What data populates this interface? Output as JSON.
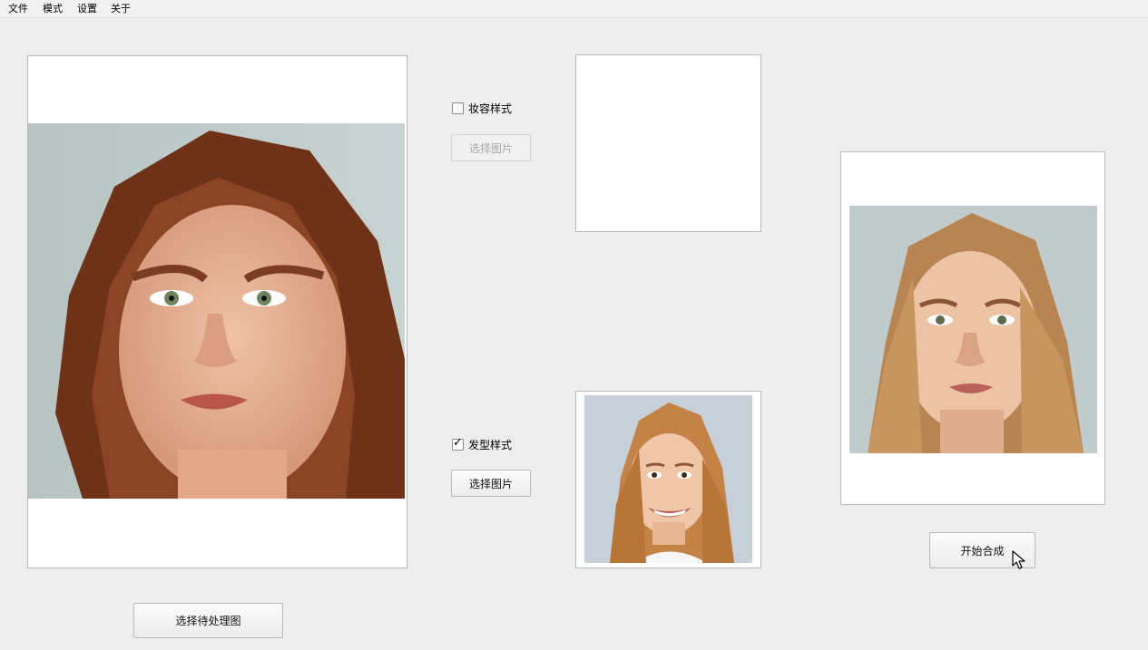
{
  "menu": {
    "items": [
      "文件",
      "模式",
      "设置",
      "关于"
    ]
  },
  "source_panel": {
    "select_button_label": "选择待处理图"
  },
  "makeup": {
    "checkbox_label": "妆容样式",
    "checked": false,
    "select_button_label": "选择图片",
    "button_enabled": false
  },
  "hair": {
    "checkbox_label": "发型样式",
    "checked": true,
    "select_button_label": "选择图片",
    "button_enabled": true
  },
  "result_panel": {
    "start_button_label": "开始合成"
  },
  "icons": {
    "cursor": "mouse-pointer-icon",
    "checkmark": "checkmark-icon"
  }
}
